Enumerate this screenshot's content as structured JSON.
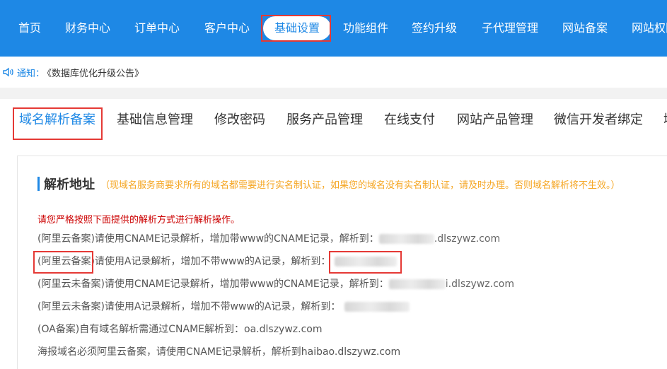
{
  "topnav": {
    "items": [
      "首页",
      "财务中心",
      "订单中心",
      "客户中心",
      "基础设置",
      "功能组件",
      "签约升级",
      "子代理管理",
      "网站备案",
      "网站权限"
    ]
  },
  "notice": {
    "label": "通知：",
    "text": "《数据库优化升级公告》"
  },
  "tabs": [
    "域名解析备案",
    "基础信息管理",
    "修改密码",
    "服务产品管理",
    "在线支付",
    "网站产品管理",
    "微信开发者绑定",
    "域"
  ],
  "section": {
    "title": "解析地址",
    "tip": "（现域名服务商要求所有的域名都需要进行实名制认证，如果您的域名没有实名制认证，请及时办理。否则域名解析将不生效。）",
    "warning": "请您严格按照下面提供的解析方式进行解析操作。",
    "rows": [
      {
        "text": "(阿里云备案)请使用CNAME记录解析，增加带www的CNAME记录，解析到：",
        "value": ".dlszywz.com"
      },
      {
        "text": "(阿里云备案)请使用A记录解析，增加不带www的A记录，解析到：",
        "value": ""
      },
      {
        "text": "(阿里云未备案)请使用CNAME记录解析，增加带www的CNAME记录，解析到：",
        "value": "i.dlszywz.com"
      },
      {
        "text": "(阿里云未备案)请使用A记录解析，增加不带www的A记录，解析到：",
        "value": ""
      },
      {
        "text": "(OA备案)自有域名解析需通过CNAME解析到：oa.dlszywz.com",
        "value": ""
      },
      {
        "text": "海报域名必须阿里云备案，请使用CNAME记录解析，解析到haibao.dlszywz.com",
        "value": ""
      }
    ]
  },
  "colors": {
    "primary": "#1e88e5",
    "highlight_box": "#e53935",
    "tip": "#f5a623",
    "warning": "#cc0000"
  }
}
